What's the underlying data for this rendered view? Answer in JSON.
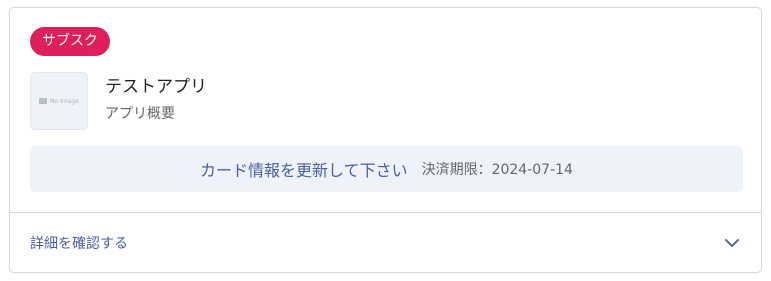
{
  "badge": {
    "label": "サブスク"
  },
  "app": {
    "thumbnail_text": "No Image",
    "name": "テストアプリ",
    "description": "アプリ概要"
  },
  "notice": {
    "link_text": "カード情報を更新して下さい",
    "deadline_text": "決済期限：2024-07-14"
  },
  "details": {
    "label": "詳細を確認する",
    "icon": "chevron-down-icon"
  },
  "colors": {
    "badge_bg": "#e01e5a",
    "accent_text": "#4a5ea8",
    "notice_bg": "#eef2fa",
    "border": "#d6d6d6"
  }
}
